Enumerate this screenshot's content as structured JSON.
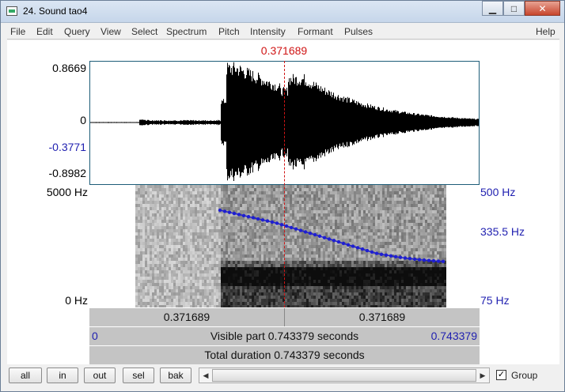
{
  "window": {
    "title": "24. Sound tao4",
    "icon": "praat-sound-icon",
    "controls": [
      "minimize",
      "maximize",
      "close"
    ]
  },
  "menu": {
    "items": [
      "File",
      "Edit",
      "Query",
      "View",
      "Select",
      "Spectrum",
      "Pitch",
      "Intensity",
      "Formant",
      "Pulses"
    ],
    "help": "Help"
  },
  "cursor": {
    "time": "0.371689",
    "color": "#d01515"
  },
  "waveform": {
    "ymax": "0.8669",
    "zero": "0",
    "cursor_value": "-0.3771",
    "ymin": "-0.8982"
  },
  "spectrogram": {
    "freq_max": "5000 Hz",
    "freq_min": "0 Hz",
    "pitch_max": "500 Hz",
    "pitch_mid": "335.5 Hz",
    "pitch_min": "75 Hz",
    "pitch_color": "#1f1fd0"
  },
  "info": {
    "left_duration": "0.371689",
    "right_duration": "0.371689",
    "visible_start": "0",
    "visible_text": "Visible part 0.743379 seconds",
    "visible_end": "0.743379",
    "total_text": "Total duration 0.743379 seconds"
  },
  "toolbar": {
    "all": "all",
    "in": "in",
    "out": "out",
    "sel": "sel",
    "bak": "bak",
    "group_label": "Group",
    "group_checked": true
  }
}
